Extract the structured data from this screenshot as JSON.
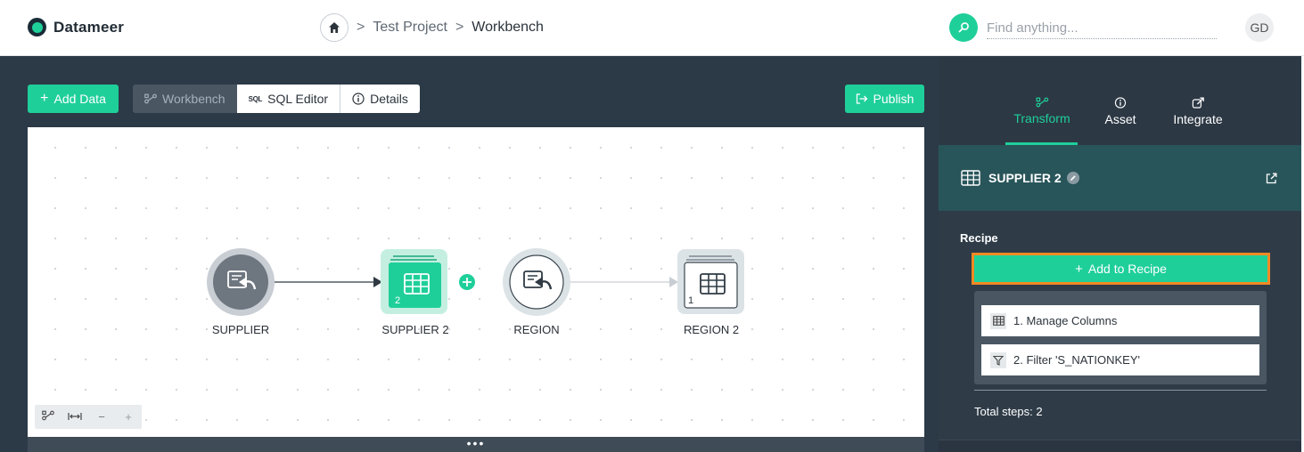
{
  "app": {
    "name": "Datameer"
  },
  "breadcrumb": {
    "project": "Test Project",
    "current": "Workbench",
    "separator": ">"
  },
  "search": {
    "placeholder": "Find anything..."
  },
  "user": {
    "initials": "GD"
  },
  "toolbar": {
    "add_data": "Add Data",
    "tabs": [
      {
        "label": "Workbench",
        "active": true
      },
      {
        "label": "SQL Editor",
        "active": false,
        "icon_text": "SQL"
      },
      {
        "label": "Details",
        "active": false
      }
    ],
    "publish": "Publish"
  },
  "flow": {
    "nodes": [
      {
        "label": "SUPPLIER",
        "kind": "source"
      },
      {
        "label": "SUPPLIER 2",
        "kind": "dataset",
        "badge": "2",
        "selected": true
      },
      {
        "label": "REGION",
        "kind": "source"
      },
      {
        "label": "REGION 2",
        "kind": "dataset",
        "badge": "1"
      }
    ]
  },
  "zoom": {
    "minus": "−",
    "plus": "+"
  },
  "panel": {
    "tabs": [
      {
        "label": "Transform",
        "active": true
      },
      {
        "label": "Asset",
        "active": false
      },
      {
        "label": "Integrate",
        "active": false
      }
    ],
    "asset_name": "SUPPLIER 2",
    "recipe_label": "Recipe",
    "add_to_recipe": "Add to Recipe",
    "steps": [
      {
        "label": "1. Manage Columns",
        "icon": "table-icon"
      },
      {
        "label": "2. Filter 'S_NATIONKEY'",
        "icon": "filter-icon"
      }
    ],
    "total": "Total steps: 2"
  },
  "colors": {
    "accent": "#1fcf9a",
    "highlight": "#f08a24",
    "dark": "#2c3a47"
  }
}
